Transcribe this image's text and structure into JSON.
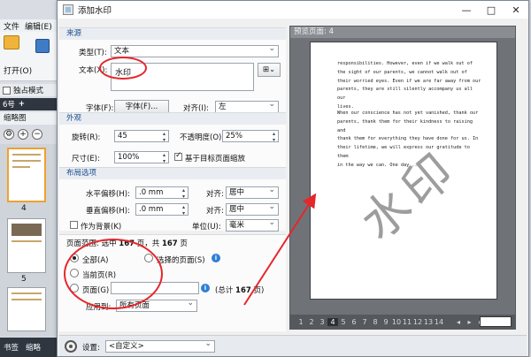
{
  "background_app": {
    "menu": [
      "文件",
      "编辑(E)"
    ],
    "open_label": "打开(O)",
    "mode_label": "独占模式",
    "tabs": [
      "6号",
      "+"
    ],
    "thumbnails_label": "缩略图",
    "thumb_numbers": [
      "4",
      "5"
    ],
    "bottom_tabs": [
      "书签",
      "缩略"
    ]
  },
  "dialog": {
    "title": "添加水印",
    "window_buttons": [
      "—",
      "□",
      "✕"
    ],
    "source": {
      "header": "来源",
      "type_label": "类型(T):",
      "type_value": "文本",
      "text_label": "文本(X):",
      "text_value": "水印",
      "font_label": "字体(F):",
      "font_button": "字体(F)...",
      "align_label": "对齐(I):",
      "align_value": "左"
    },
    "appearance": {
      "header": "外观",
      "rotation_label": "旋转(R):",
      "rotation_value": "45",
      "opacity_label": "不透明度(O):",
      "opacity_value": "25%",
      "size_label": "尺寸(E):",
      "size_value": "100%",
      "scale_checkbox_label": "基于目标页面缩放"
    },
    "layout": {
      "header": "布局选项",
      "h_offset_label": "水平偏移(H):",
      "h_offset_value": ".0 mm",
      "h_align_label": "对齐:",
      "h_align_value": "居中",
      "v_offset_label": "垂直偏移(H):",
      "v_offset_value": ".0 mm",
      "v_align_label": "对齐:",
      "v_align_value": "居中",
      "background_checkbox_label": "作为背景(K)",
      "unit_label": "单位(U):",
      "unit_value": "毫米"
    },
    "page_range": {
      "header_prefix": "页面范围: 选中",
      "selected_count": "167",
      "header_mid": "页，共",
      "total_count": "167",
      "header_suffix": "页",
      "all_label": "全部(A)",
      "selected_pages_label": "选择的页面(S)",
      "current_label": "当前页(R)",
      "pages_label": "页面(G)",
      "pages_total_prefix": "(总计",
      "pages_total_suffix": "页)",
      "apply_label": "应用到:",
      "apply_value": "所有页面"
    },
    "preview": {
      "header": "预览页面: 4",
      "paragraph1": "responsibilities. However, even if we walk out of\nthe sight of our parents, we cannot walk out of\ntheir worried eyes. Even if we are far away from our\nparents, they are still silently accompany us all our\nlives.",
      "paragraph2": "When our conscience has not yet vanished, thank our\nparents, thank them for their kindness to raising and\nthank them for everything they have done for us. In\ntheir lifetime, we will express our gratitude to them\nin the way we can. One day...",
      "watermark_text": "水印",
      "pages": [
        "1",
        "2",
        "3",
        "4",
        "5",
        "6",
        "7",
        "8",
        "9",
        "10",
        "11",
        "12",
        "13",
        "14"
      ],
      "active_page": "4"
    },
    "footer": {
      "settings_label": "设置:",
      "settings_value": "<自定义>"
    }
  },
  "colors": {
    "annotation_red": "#e6262b",
    "section_header_text": "#1f4f8f"
  }
}
